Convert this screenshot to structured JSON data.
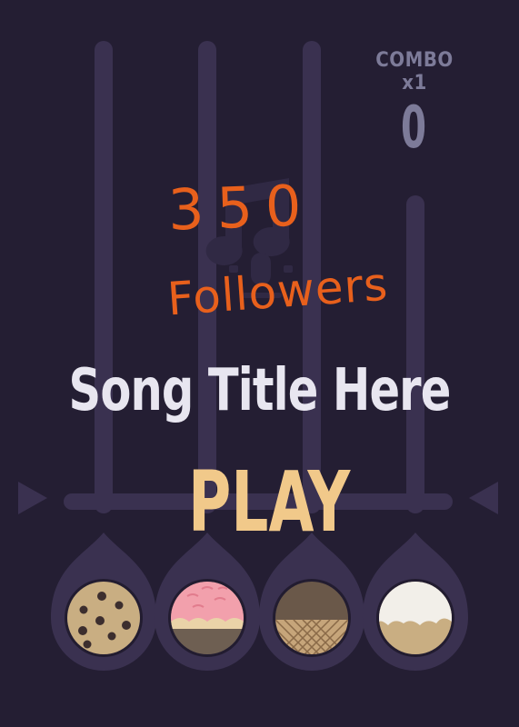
{
  "combo": {
    "label": "COMBO x1",
    "value": "0"
  },
  "song": {
    "title": "Song Title Here"
  },
  "play": {
    "label": "PLAY"
  },
  "overlay": {
    "line1": "350",
    "line2": "Followers"
  },
  "colors": {
    "background": "#241e33",
    "track": "#3a3150",
    "text": "#e8e6f0",
    "play": "#f1c98a",
    "combo": "#7d7b99",
    "handwriting": "#e8601c"
  },
  "lanes": [
    {
      "flavor": "cookie"
    },
    {
      "flavor": "strawberry"
    },
    {
      "flavor": "chocolate-waffle"
    },
    {
      "flavor": "vanilla"
    }
  ]
}
